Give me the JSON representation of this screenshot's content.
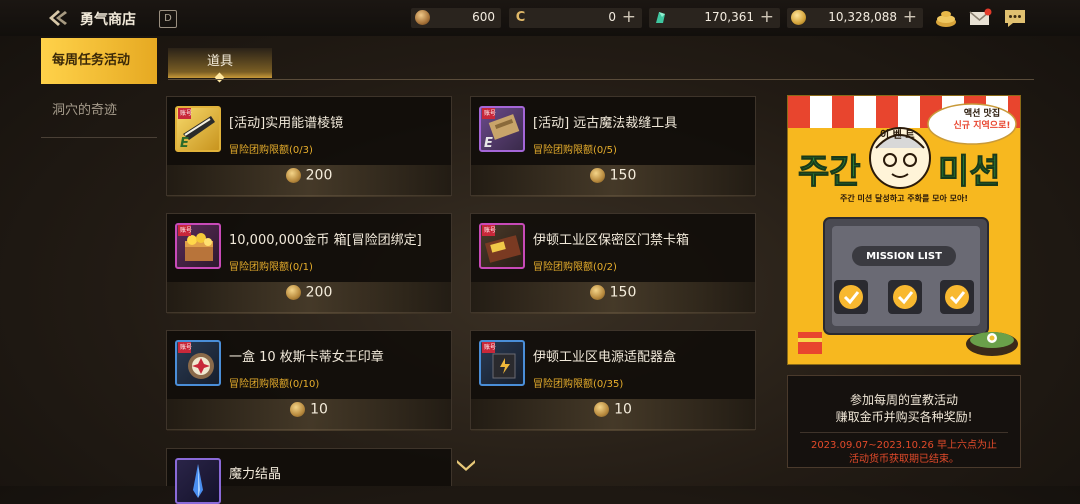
{
  "header": {
    "title": "勇气商店",
    "calendar_glyph": "D",
    "currencies": [
      {
        "name": "bronze-coin",
        "value": "600",
        "plus": false
      },
      {
        "name": "cera-point",
        "glyph": "C",
        "value": "0",
        "plus": true
      },
      {
        "name": "green-crystal",
        "value": "170,361",
        "plus": true
      },
      {
        "name": "gold",
        "value": "10,328,088",
        "plus": true
      }
    ],
    "plus_glyph": "+"
  },
  "sidebar": {
    "items": [
      {
        "label": "每周任务活动",
        "active": true
      },
      {
        "label": "洞穴的奇迹",
        "active": false
      }
    ]
  },
  "tabs": [
    {
      "label": "道具",
      "active": true
    }
  ],
  "items": [
    {
      "name": "[活动]实用能谱棱镜",
      "limit": "冒险团购限额(0/3)",
      "price": "200",
      "badge": "账号",
      "grade": "E",
      "frame": "#e0b23a"
    },
    {
      "name": "[活动] 远古魔法裁缝工具",
      "limit": "冒险团购限额(0/5)",
      "price": "150",
      "badge": "账号",
      "grade": "E",
      "frame": "#a466d8"
    },
    {
      "name": "10,000,000金币 箱[冒险团绑定]",
      "limit": "冒险团购限额(0/1)",
      "price": "200",
      "badge": "账号",
      "frame": "#c84ab8"
    },
    {
      "name": "伊顿工业区保密区门禁卡箱",
      "limit": "冒险团购限额(0/2)",
      "price": "150",
      "badge": "账号",
      "frame": "#c84ab8"
    },
    {
      "name": "一盒 10 枚斯卡蒂女王印章",
      "limit": "冒险团购限额(0/10)",
      "price": "10",
      "badge": "账号",
      "frame": "#4a8ed8"
    },
    {
      "name": "伊顿工业区电源适配器盒",
      "limit": "冒险团购限额(0/35)",
      "price": "10",
      "badge": "账号",
      "frame": "#4a8ed8"
    },
    {
      "name": "魔力结晶",
      "limit": "",
      "price": "",
      "badge": "",
      "frame": "#8a6ad8"
    }
  ],
  "banner": {
    "title_left": "주간",
    "title_right": "미션",
    "event_label": "이 벤 트",
    "bubble_line1": "액션 맛집",
    "bubble_line2": "신규 지역으로!",
    "subtitle": "주간 미션 달성하고 주화를 모아 모아!",
    "mission_list_label": "MISSION LIST"
  },
  "notice": {
    "line1": "参加每周的宣教活动",
    "line2": "赚取金币并购买各种奖励!",
    "date_line": "2023.09.07~2023.10.26 早上六点为止",
    "warning_line": "活动货币获取期已结束。"
  },
  "colors": {
    "accent_gold": "#f5c33a",
    "limit_text": "#e7ae2c",
    "warning_red": "#e24a2a",
    "banner_yellow": "#f7b81f"
  }
}
